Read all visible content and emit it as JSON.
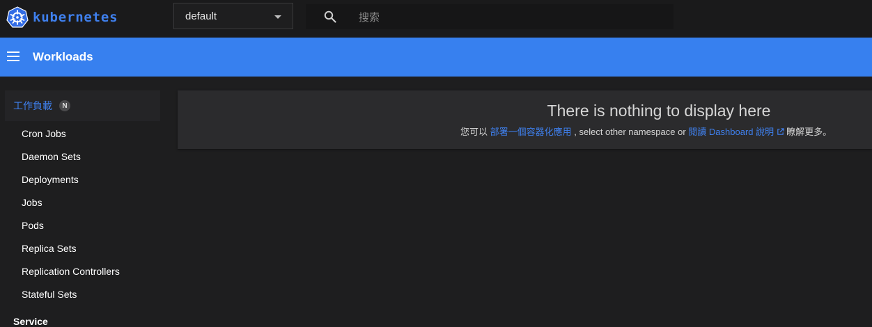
{
  "header": {
    "brand_name": "kubernetes",
    "namespace": "default",
    "search_placeholder": "搜索",
    "accent": "#3780ef"
  },
  "toolbar": {
    "title": "Workloads"
  },
  "sidebar": {
    "header_label": "工作負載",
    "header_badge": "N",
    "items": [
      {
        "label": "Cron Jobs"
      },
      {
        "label": "Daemon Sets"
      },
      {
        "label": "Deployments"
      },
      {
        "label": "Jobs"
      },
      {
        "label": "Pods"
      },
      {
        "label": "Replica Sets"
      },
      {
        "label": "Replication Controllers"
      },
      {
        "label": "Stateful Sets"
      }
    ],
    "next_section": "Service"
  },
  "main": {
    "empty_title": "There is nothing to display here",
    "text_before": "您可以 ",
    "deploy_link": "部署一個容器化應用",
    "text_middle": " , select other namespace or ",
    "docs_link": "閱讀 Dashboard 說明",
    "text_after": "瞭解更多。"
  }
}
